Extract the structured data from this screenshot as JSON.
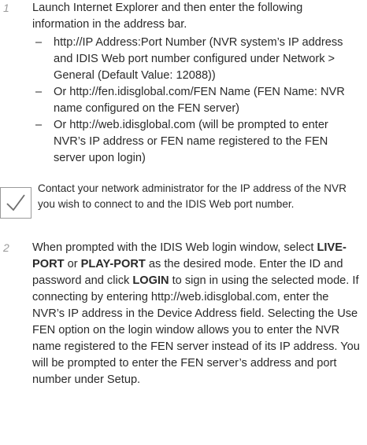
{
  "step1": {
    "number": "1",
    "text": "Launch Internet Explorer and then enter the following information in the address bar.",
    "items": [
      "http://IP Address:Port Number (NVR system’s IP address and IDIS Web port number configured under Network > General (Default Value: 12088))",
      "Or http://fen.idisglobal.com/FEN Name (FEN Name: NVR name configured on the FEN server)",
      "Or http://web.idisglobal.com (will be prompted to enter NVR’s IP address or FEN name registered to the FEN server upon login)"
    ]
  },
  "note": {
    "icon": "checkmark-icon",
    "text": "Contact your network administrator for the IP address of the NVR you wish to connect to and the IDIS Web port number."
  },
  "step2": {
    "number": "2",
    "seg1": "When prompted with the IDIS Web login window, select ",
    "live_port": "LIVE-PORT",
    "seg2": " or ",
    "play_port": "PLAY-PORT",
    "seg3": " as the desired mode. Enter the ID and password and click ",
    "login": "LOGIN",
    "seg4": " to sign in using the selected mode. If connecting by entering http://web.idisglobal.com, enter the NVR’s IP address in the Device Address field.  Selecting the Use FEN option on the login window allows you to enter the NVR name registered to the FEN server instead of its IP address. You will be prompted to enter the FEN server’s address and port number under Setup."
  },
  "colors": {
    "step_number": "#9a9a9a",
    "text": "#2a2a2a"
  }
}
